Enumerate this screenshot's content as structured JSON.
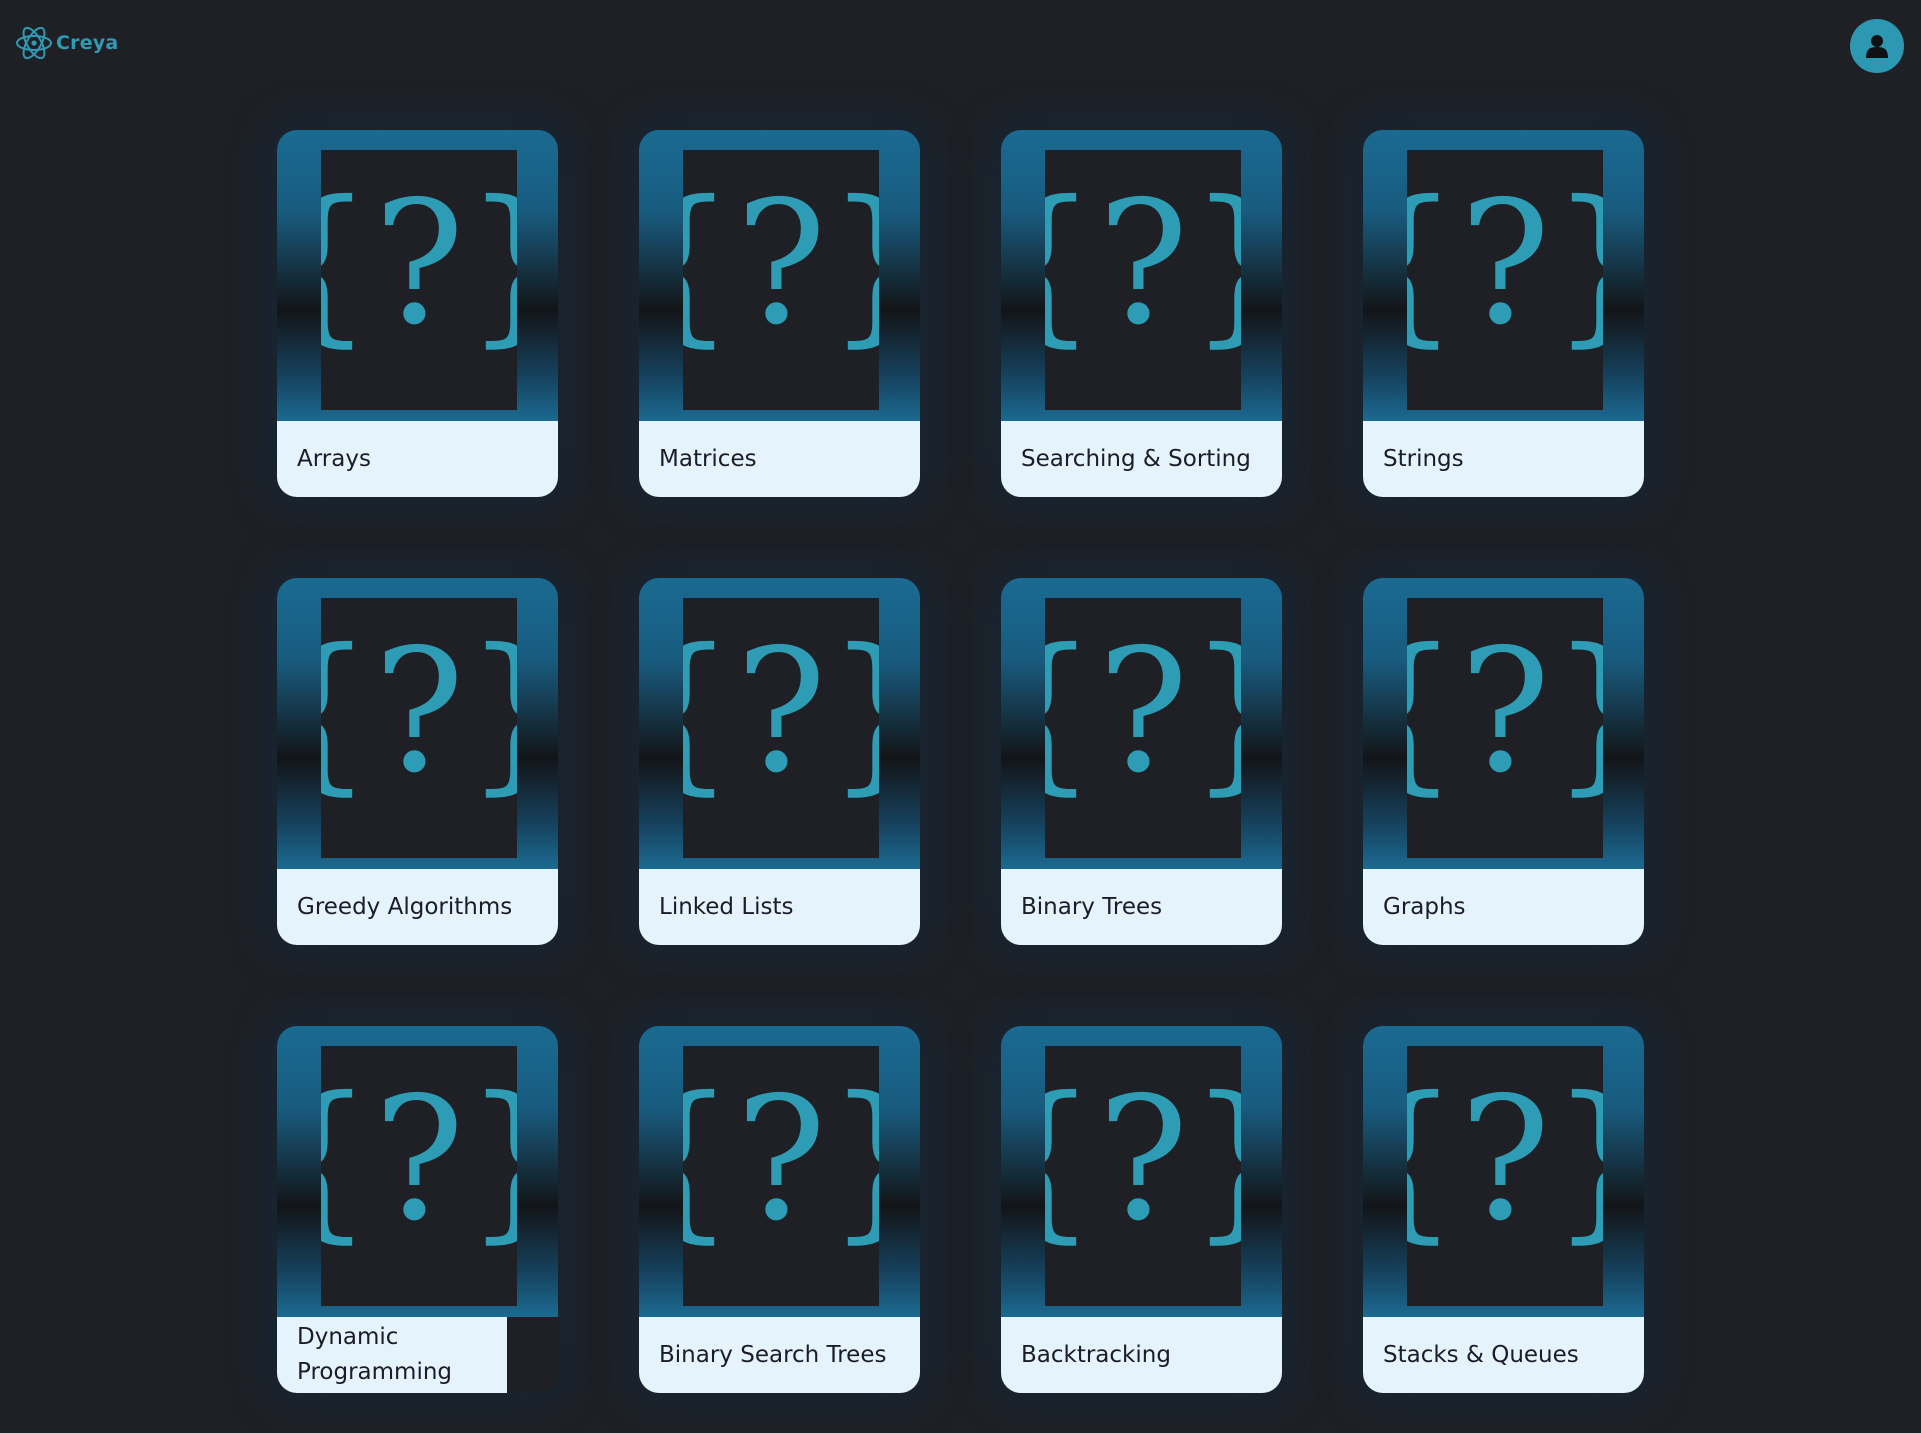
{
  "header": {
    "logo_text": "Creya",
    "logo_icon": "atom-icon",
    "profile_icon": "user-icon"
  },
  "colors": {
    "background": "#1e2026",
    "accent": "#2f9bb3",
    "card_label_bg": "#e5f3fd",
    "card_gradient_top": "#1a6a92"
  },
  "topics": [
    {
      "label": "Arrays",
      "icon": "code-question-icon"
    },
    {
      "label": "Matrices",
      "icon": "code-question-icon"
    },
    {
      "label": "Searching & Sorting",
      "icon": "code-question-icon"
    },
    {
      "label": "Strings",
      "icon": "code-question-icon"
    },
    {
      "label": "Greedy Algorithms",
      "icon": "code-question-icon"
    },
    {
      "label": "Linked Lists",
      "icon": "code-question-icon"
    },
    {
      "label": "Binary Trees",
      "icon": "code-question-icon"
    },
    {
      "label": "Graphs",
      "icon": "code-question-icon"
    },
    {
      "label": "Dynamic Programming",
      "icon": "code-question-icon"
    },
    {
      "label": "Binary Search Trees",
      "icon": "code-question-icon"
    },
    {
      "label": "Backtracking",
      "icon": "code-question-icon"
    },
    {
      "label": "Stacks & Queues",
      "icon": "code-question-icon"
    }
  ]
}
